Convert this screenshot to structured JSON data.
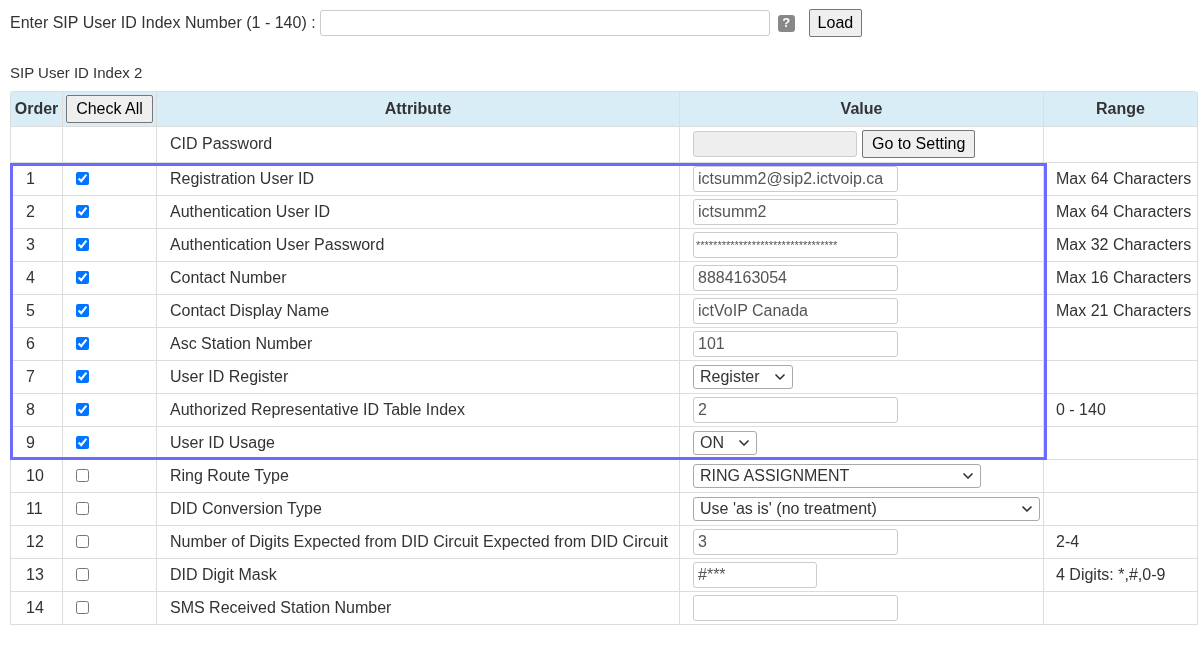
{
  "lookup": {
    "label": "Enter SIP User ID Index Number (1 - 140) :",
    "help_icon": "?",
    "button": "Load"
  },
  "section_title": "SIP User ID Index 2",
  "table": {
    "columns": [
      "Order",
      "Attribute",
      "Value",
      "Range"
    ],
    "check_all": "Check All",
    "cid_row": {
      "attribute": "CID Password",
      "button": "Go to Setting"
    },
    "rows": [
      {
        "order": "1",
        "checked": true,
        "highlighted": true,
        "attribute": "Registration User ID",
        "kind": "input",
        "value": "ictsumm2@sip2.ictvoip.ca",
        "range": "Max 64 Characters"
      },
      {
        "order": "2",
        "checked": true,
        "highlighted": true,
        "attribute": "Authentication User ID",
        "kind": "input",
        "value": "ictsumm2",
        "range": "Max 64 Characters"
      },
      {
        "order": "3",
        "checked": true,
        "highlighted": true,
        "attribute": "Authentication User Password",
        "kind": "password",
        "value": "*********************************",
        "range": "Max 32 Characters"
      },
      {
        "order": "4",
        "checked": true,
        "highlighted": true,
        "attribute": "Contact Number",
        "kind": "input",
        "value": "8884163054",
        "range": "Max 16 Characters"
      },
      {
        "order": "5",
        "checked": true,
        "highlighted": true,
        "attribute": "Contact Display Name",
        "kind": "input",
        "value": "ictVoIP Canada",
        "range": "Max 21 Characters"
      },
      {
        "order": "6",
        "checked": true,
        "highlighted": true,
        "attribute": "Asc Station Number",
        "kind": "input",
        "value": "101"
      },
      {
        "order": "7",
        "checked": true,
        "highlighted": true,
        "attribute": "User ID Register",
        "kind": "select",
        "value": "Register"
      },
      {
        "order": "8",
        "checked": true,
        "highlighted": true,
        "attribute": "Authorized Representative ID Table Index",
        "kind": "input",
        "value": "2",
        "range": "0 - 140"
      },
      {
        "order": "9",
        "checked": true,
        "highlighted": true,
        "attribute": "User ID Usage",
        "kind": "select",
        "value": "ON"
      },
      {
        "order": "10",
        "checked": false,
        "highlighted": false,
        "attribute": "Ring Route Type",
        "kind": "wide_select",
        "value": "RING ASSIGNMENT"
      },
      {
        "order": "11",
        "checked": false,
        "highlighted": false,
        "attribute": "DID Conversion Type",
        "kind": "wider_select",
        "value": "Use 'as is' (no treatment)"
      },
      {
        "order": "12",
        "checked": false,
        "highlighted": false,
        "attribute": "Number of Digits Expected from DID Circuit Expected from DID Circuit",
        "kind": "input",
        "value": "3",
        "range": "2-4"
      },
      {
        "order": "13",
        "checked": false,
        "highlighted": false,
        "attribute": "DID Digit Mask",
        "kind": "short_input",
        "value": "#***",
        "range": "4 Digits: *,#,0-9"
      },
      {
        "order": "14",
        "checked": false,
        "highlighted": false,
        "attribute": "SMS Received Station Number",
        "kind": "input"
      }
    ]
  }
}
